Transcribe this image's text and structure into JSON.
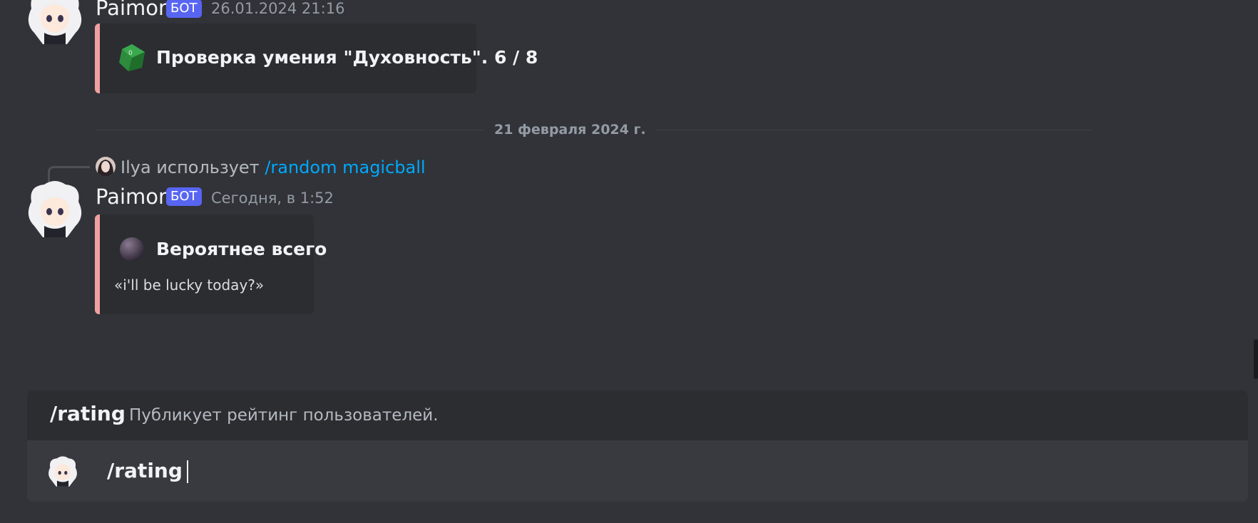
{
  "messages": [
    {
      "author": "Paimon",
      "bot_tag": "БОТ",
      "timestamp": "26.01.2024 21:16",
      "embed": {
        "icon": "green-d8-dice-icon",
        "title": "Проверка умения \"Духовность\". 6 / 8"
      }
    },
    {
      "reply": {
        "user": "Ilya",
        "verb": "использует",
        "command": "/random magicball"
      },
      "author": "Paimon",
      "bot_tag": "БОТ",
      "timestamp": "Сегодня, в 1:52",
      "embed": {
        "icon": "magic-8-ball-icon",
        "title": "Вероятнее всего",
        "description": "«i'll be lucky today?»"
      }
    }
  ],
  "date_divider": "21 февраля 2024 г.",
  "autocomplete": {
    "command": "/rating",
    "description": "Публикует рейтинг пользователей."
  },
  "composer": {
    "value": "/rating"
  },
  "colors": {
    "background": "#313338",
    "embed_border": "#f0a0a0",
    "bot_tag": "#5865f2",
    "link": "#00a8fc"
  }
}
